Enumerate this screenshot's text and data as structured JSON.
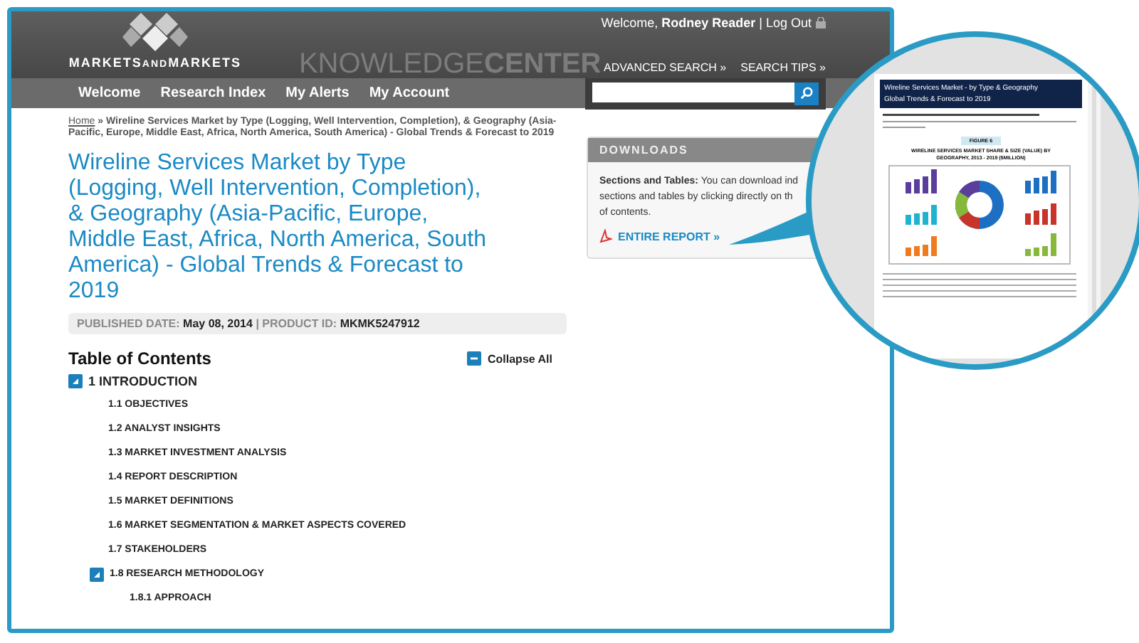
{
  "header": {
    "logo": {
      "first": "MARKETS",
      "middle": "AND",
      "last": "MARKETS"
    },
    "brand": {
      "light": "KNOWLEDGE",
      "bold": "CENTER"
    },
    "welcome": "Welcome, **Rodney Reader** | Log Out",
    "links": [
      "ADVANCED SEARCH »",
      "SEARCH TIPS »"
    ]
  },
  "nav": {
    "items": [
      "Welcome",
      "Research Index",
      "My Alerts",
      "My Account"
    ]
  },
  "breadcrumb": {
    "home": "Home",
    "rest": "» Wireline Services Market by Type (Logging, Well Intervention, Completion), & Geography (Asia-Pacific, Europe, Middle East, Africa, North America, South America) - Global Trends & Forecast to 2019"
  },
  "title": "Wireline Services Market by Type (Logging, Well Intervention, Completion), & Geography (Asia-Pacific, Europe, Middle East, Africa, North America, South America) - Global Trends & Forecast to 2019",
  "meta": "PUBLISHED DATE: **May 08, 2014** | PRODUCT ID: **MKMK5247912**",
  "toc": {
    "heading": "Table of Contents",
    "collapse": "Collapse All",
    "items": [
      {
        "label": "1 INTRODUCTION",
        "expanded": true,
        "children": [
          {
            "label": "1.1 OBJECTIVES"
          },
          {
            "label": "1.2 ANALYST INSIGHTS"
          },
          {
            "label": "1.3 MARKET INVESTMENT ANALYSIS"
          },
          {
            "label": "1.4 REPORT DESCRIPTION"
          },
          {
            "label": "1.5 MARKET DEFINITIONS"
          },
          {
            "label": "1.6 MARKET SEGMENTATION & MARKET ASPECTS COVERED"
          },
          {
            "label": "1.7 STAKEHOLDERS"
          },
          {
            "label": "1.8 RESEARCH METHODOLOGY",
            "expanded": true,
            "children": [
              {
                "label": "1.8.1 APPROACH"
              }
            ]
          }
        ]
      }
    ]
  },
  "downloads": {
    "title": "DOWNLOADS",
    "lines": [
      "**Sections and Tables:** You can download ind",
      "sections and tables by clicking directly on th",
      "of contents."
    ],
    "link": "ENTIRE REPORT »"
  },
  "magnifier": {
    "doc_header": [
      "Wireline Services Market - by Type & Geography",
      "Global Trends & Forecast to 2019"
    ],
    "figure": "FIGURE 6",
    "chart_title": "WIRELINE SERVICES MARKET SHARE & SIZE (VALUE) BY GEOGRAPHY, 2013 - 2019 ($MILLION)"
  }
}
